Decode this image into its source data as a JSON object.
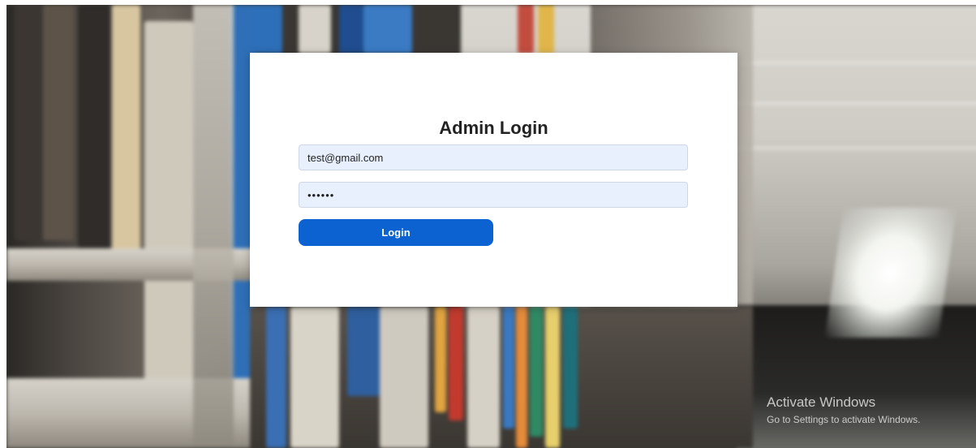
{
  "login": {
    "title": "Admin Login",
    "email_value": "test@gmail.com",
    "password_value": "••••••",
    "button_label": "Login"
  },
  "watermark": {
    "title": "Activate Windows",
    "subtitle": "Go to Settings to activate Windows."
  },
  "colors": {
    "button": "#0b62d0",
    "input_bg": "#e8f0fe",
    "card_bg": "#ffffff"
  }
}
